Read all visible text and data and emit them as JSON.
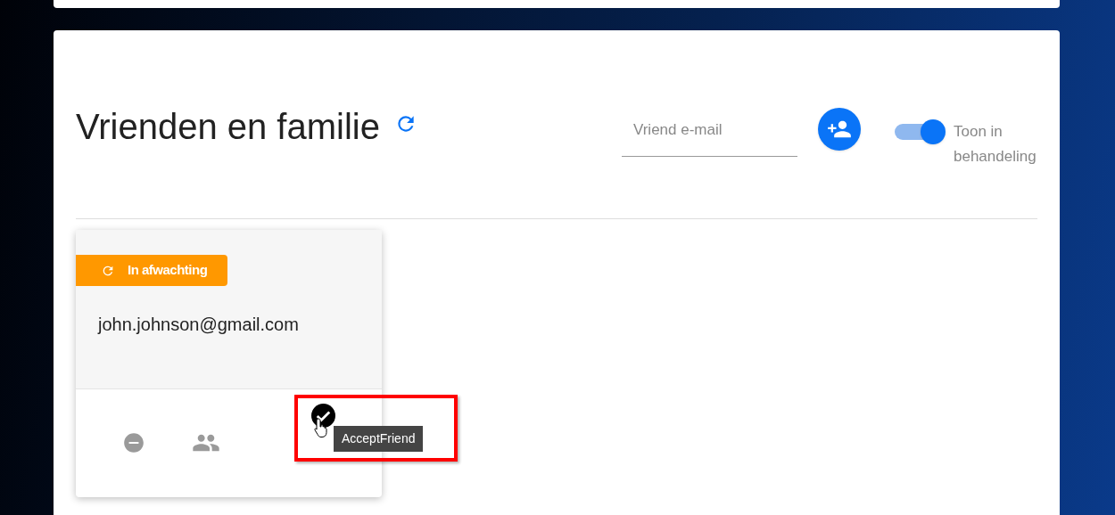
{
  "page": {
    "title": "Vrienden en familie"
  },
  "email_field": {
    "placeholder": "Vriend e-mail"
  },
  "show_pending": {
    "label": "Toon in behandeling",
    "on": true
  },
  "friends": [
    {
      "status": {
        "kind": "pending",
        "label": "In afwachting"
      },
      "email": "john.johnson@gmail.com",
      "tooltip": "AcceptFriend",
      "highlighted": true
    }
  ]
}
